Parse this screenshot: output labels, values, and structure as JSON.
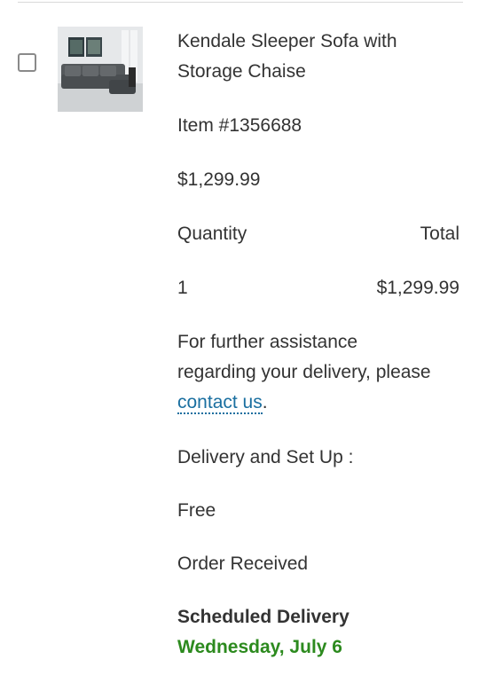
{
  "product": {
    "name_line1": "Kendale Sleeper Sofa with",
    "name_line2": "Storage Chaise",
    "item_number": "Item #1356688",
    "price": "$1,299.99",
    "image_icon": "sectional-sofa-photo"
  },
  "order_table": {
    "quantity_label": "Quantity",
    "total_label": "Total",
    "quantity_value": "1",
    "total_value": "$1,299.99"
  },
  "assistance": {
    "line1": "For further assistance",
    "line2": "regarding your delivery, please",
    "link_text": "contact us",
    "suffix": "."
  },
  "delivery": {
    "label": "Delivery and Set Up :",
    "fee": "Free",
    "status": "Order Received",
    "schedule_title": "Scheduled Delivery",
    "schedule_date": "Wednesday, July 6"
  },
  "colors": {
    "link": "#1a6fa0",
    "delivery_date": "#2c8a1e",
    "text": "#333333"
  }
}
